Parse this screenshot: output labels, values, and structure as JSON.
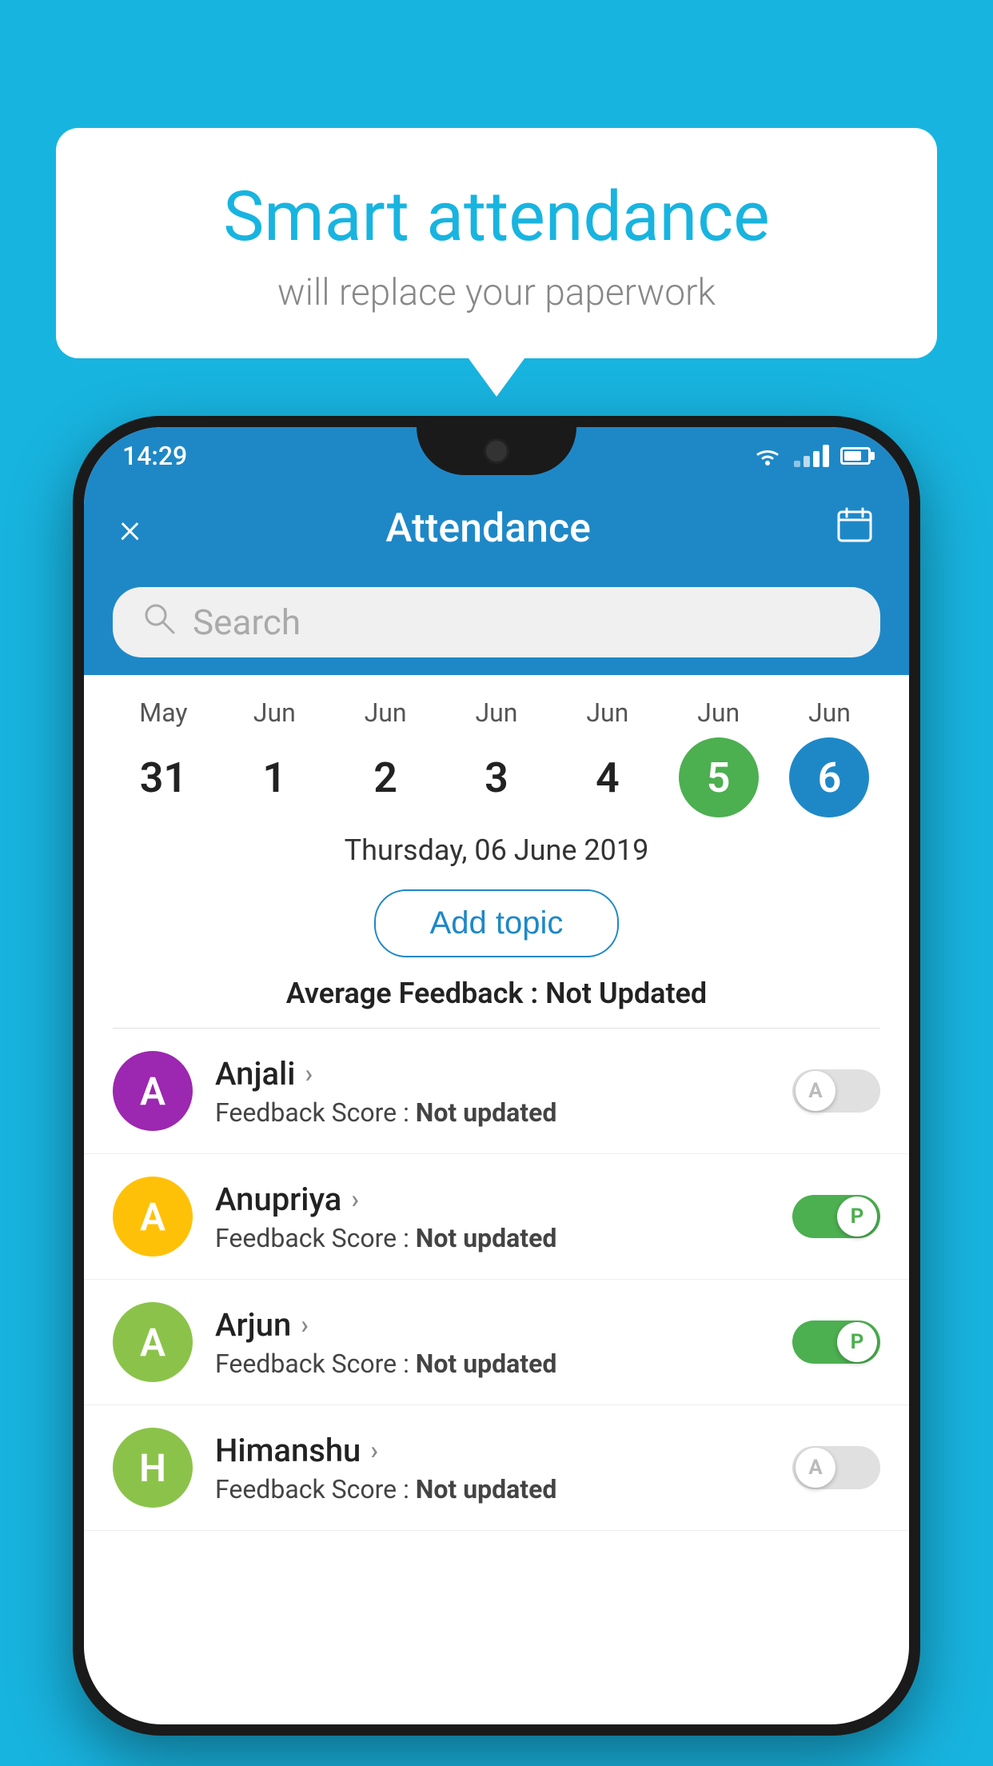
{
  "background_color": "#18B4E0",
  "speech_bubble": {
    "title": "Smart attendance",
    "subtitle": "will replace your paperwork"
  },
  "status_bar": {
    "time": "14:29",
    "icons": [
      "wifi",
      "signal",
      "battery"
    ]
  },
  "toolbar": {
    "close_label": "×",
    "title": "Attendance",
    "calendar_icon": "📅"
  },
  "search": {
    "placeholder": "Search"
  },
  "calendar": {
    "days": [
      {
        "month": "May",
        "date": "31",
        "state": "normal"
      },
      {
        "month": "Jun",
        "date": "1",
        "state": "normal"
      },
      {
        "month": "Jun",
        "date": "2",
        "state": "normal"
      },
      {
        "month": "Jun",
        "date": "3",
        "state": "normal"
      },
      {
        "month": "Jun",
        "date": "4",
        "state": "normal"
      },
      {
        "month": "Jun",
        "date": "5",
        "state": "today"
      },
      {
        "month": "Jun",
        "date": "6",
        "state": "selected"
      }
    ]
  },
  "selected_date": "Thursday, 06 June 2019",
  "add_topic_label": "Add topic",
  "avg_feedback_label": "Average Feedback :",
  "avg_feedback_value": "Not Updated",
  "students": [
    {
      "name": "Anjali",
      "avatar_letter": "A",
      "avatar_color": "#9C27B0",
      "feedback_label": "Feedback Score :",
      "feedback_value": "Not updated",
      "toggle": "off",
      "toggle_label": "A"
    },
    {
      "name": "Anupriya",
      "avatar_letter": "A",
      "avatar_color": "#FFC107",
      "feedback_label": "Feedback Score :",
      "feedback_value": "Not updated",
      "toggle": "on",
      "toggle_label": "P"
    },
    {
      "name": "Arjun",
      "avatar_letter": "A",
      "avatar_color": "#8BC34A",
      "feedback_label": "Feedback Score :",
      "feedback_value": "Not updated",
      "toggle": "on",
      "toggle_label": "P"
    },
    {
      "name": "Himanshu",
      "avatar_letter": "H",
      "avatar_color": "#8BC34A",
      "feedback_label": "Feedback Score :",
      "feedback_value": "Not updated",
      "toggle": "off",
      "toggle_label": "A"
    }
  ]
}
